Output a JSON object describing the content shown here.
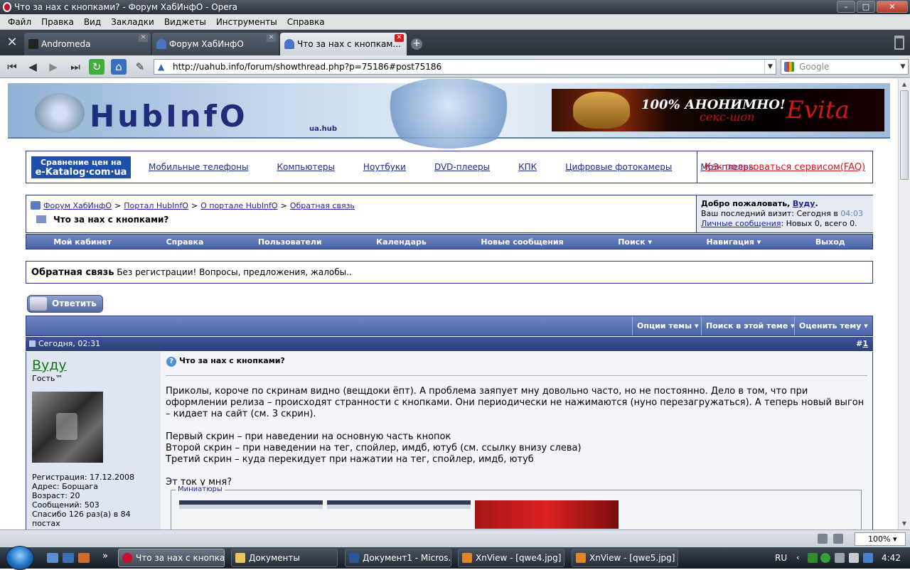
{
  "window": {
    "title": "Что за нах с кнопками? - Форум ХабИнфО - Opera",
    "min": "–",
    "max": "□",
    "close": "✕"
  },
  "menu": [
    "Файл",
    "Правка",
    "Вид",
    "Закладки",
    "Виджеты",
    "Инструменты",
    "Справка"
  ],
  "tabs": [
    {
      "label": "Andromeda"
    },
    {
      "label": "Форум ХабИнфО"
    },
    {
      "label": "Что за нах с кнопкам..."
    }
  ],
  "address": {
    "url": "http://uahub.info/forum/showthread.php?p=75186#post75186",
    "search_placeholder": "Google"
  },
  "banner": {
    "logo": "HubInfO",
    "logo_sub": "ua.hub",
    "ad_line1": "100% АНОНИМНО!",
    "ad_line2": "секс-шоп",
    "ad_brand": "Evita"
  },
  "catalog": {
    "logo_line1": "Сравнение цен на",
    "logo_line2": "e-Katalog·com·ua",
    "links": [
      "Мобильные телефоны",
      "Компьютеры",
      "Ноутбуки",
      "DVD-плееры",
      "КПК",
      "Цифровые фотокамеры",
      "Mp3-плееры"
    ],
    "faq": "Как пользоваться сервисом(FAQ)"
  },
  "breadcrumb": [
    "Форум ХабИнфО",
    "Портал HubInfO",
    "О портале HubInfO",
    "Обратная связь"
  ],
  "breadcrumb_sep": ">",
  "thread_title": "Что за нах с кнопками?",
  "welcome": {
    "greeting": "Добро пожаловать,",
    "user": "Вуду",
    "dot": ".",
    "last_visit": "Ваш последний визит: Сегодня в",
    "last_time": "04:03",
    "pm_link": "Личные сообщения",
    "pm_text": ": Новых 0, всего 0."
  },
  "navmenu": [
    "Мой кабинет",
    "Справка",
    "Пользователи",
    "Календарь",
    "Новые сообщения",
    "Поиск ▾",
    "Навигация ▾",
    "Выход"
  ],
  "forum": {
    "name": "Обратная связь",
    "desc": "Без регистрации! Вопросы, предложения, жалобы.."
  },
  "reply_label": "Ответить",
  "thread_tools": [
    "Опции темы ▾",
    "Поиск в этой теме ▾",
    "Оценить тему ▾"
  ],
  "post": {
    "date": "Сегодня, 02:31",
    "hash": "#",
    "number": "1",
    "user": "Вуду",
    "user_title": "Гость™",
    "info": [
      "Регистрация: 17.12.2008",
      "Адрес: Борщага",
      "Возраст: 20",
      "Сообщений: 503",
      "Спасибо 126 раз(а) в 84",
      "постах"
    ],
    "title": "Что за нах с кнопками?",
    "paragraphs": [
      "Приколы, короче по скринам видно (вещдоки ёпт). А проблема заяпует мну довольно часто, но не постоянно. Дело в том, что при оформлении релиза – происходят странности с кнопками. Они периодически не нажимаются (нуно перезагружаться). А теперь новый выгон – кидает на сайт (см. 3 скрин).",
      "Первый скрин – при наведении на основную часть кнопок\nВторой скрин – при наведении на тег, спойлер, имдб, ютуб (см. ссылку внизу слева)\nТретий скрин – куда перекидует при нажатии на тег, спойлер, имдб, ютуб",
      "Эт ток у мня?"
    ],
    "thumbs_legend": "Миниатюры"
  },
  "status": {
    "zoom": "100%"
  },
  "taskbar": {
    "tasks": [
      "Что за нах с кнопка...",
      "Документы",
      "Документ1 - Micros...",
      "XnView - [qwe4.jpg]",
      "XnView - [qwe5.jpg]"
    ],
    "lang": "RU",
    "clock": "4:42",
    "chevron": "»"
  },
  "colors": {
    "accent": "#2b3a8a",
    "menu_bar": "#4a63a7",
    "user_link": "#137a13",
    "faq_link": "#d81818"
  }
}
